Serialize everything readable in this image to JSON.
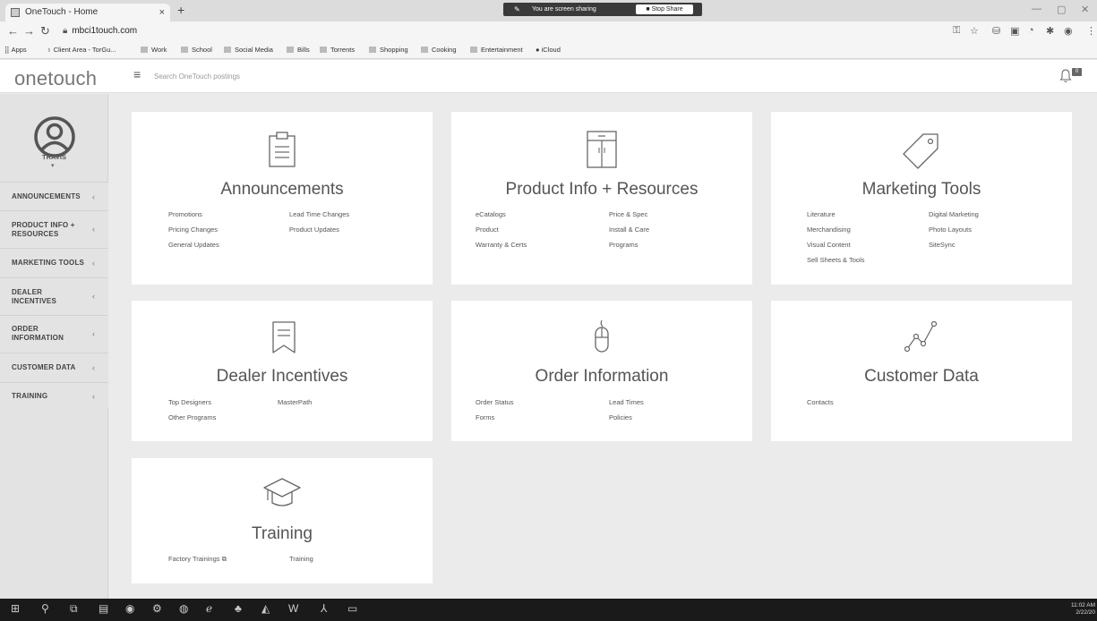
{
  "browser": {
    "tab_title": "OneTouch - Home",
    "tab_close": "×",
    "new_tab": "+",
    "share_text": "You are screen sharing",
    "stop_share": "■ Stop Share",
    "url": "mbci1touch.com",
    "bookmarks": [
      "Apps",
      "Client Area - TorGu...",
      "Work",
      "School",
      "Social Media",
      "Bills",
      "Torrents",
      "Shopping",
      "Cooking",
      "Entertainment",
      "iCloud"
    ]
  },
  "header": {
    "logo": "onetouch",
    "search_placeholder": "Search OneTouch postings",
    "notification_count": "0"
  },
  "sidebar": {
    "username": "TRAVIS",
    "items": [
      {
        "label": "ANNOUNCEMENTS"
      },
      {
        "label": "PRODUCT INFO +\nRESOURCES"
      },
      {
        "label": "MARKETING TOOLS"
      },
      {
        "label": "DEALER\nINCENTIVES"
      },
      {
        "label": "ORDER\nINFORMATION"
      },
      {
        "label": "CUSTOMER DATA"
      },
      {
        "label": "TRAINING"
      }
    ]
  },
  "cards": {
    "announcements": {
      "title": "Announcements",
      "links": [
        "Promotions",
        "Lead Time Changes",
        "Pricing Changes",
        "Product Updates",
        "General Updates"
      ]
    },
    "product_info": {
      "title": "Product Info + Resources",
      "links": [
        "eCatalogs",
        "Price & Spec",
        "Product",
        "Install & Care",
        "Warranty & Certs",
        "Programs"
      ]
    },
    "marketing": {
      "title": "Marketing Tools",
      "links": [
        "Literature",
        "Digital Marketing",
        "Merchandising",
        "Photo Layouts",
        "Visual Content",
        "SiteSync",
        "Sell Sheets & Tools"
      ]
    },
    "dealer": {
      "title": "Dealer Incentives",
      "links": [
        "Top Designers",
        "MasterPath",
        "Other Programs"
      ]
    },
    "order": {
      "title": "Order Information",
      "links": [
        "Order Status",
        "Lead Times",
        "Forms",
        "Policies"
      ]
    },
    "customer": {
      "title": "Customer Data",
      "links": [
        "Contacts"
      ]
    },
    "training": {
      "title": "Training",
      "links": [
        "Factory Trainings",
        "Training"
      ]
    }
  },
  "taskbar": {
    "time": "11:02 AM",
    "date": "2/22/20"
  }
}
